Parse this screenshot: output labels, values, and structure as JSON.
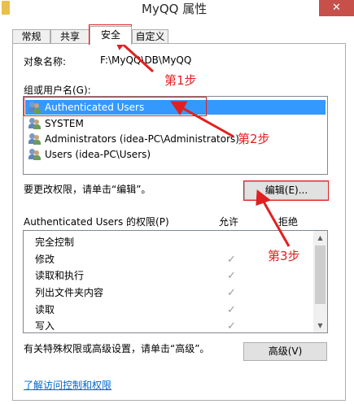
{
  "window": {
    "title": "MyQQ 属性",
    "close_glyph": "✕"
  },
  "tabs": [
    {
      "label": "常规"
    },
    {
      "label": "共享"
    },
    {
      "label": "安全"
    },
    {
      "label": "自定义"
    }
  ],
  "object": {
    "label": "对象名称:",
    "value": "F:\\MyQQ\\DB\\MyQQ"
  },
  "groups": {
    "label": "组或用户名(G):",
    "users": [
      {
        "name": "Authenticated Users",
        "selected": true
      },
      {
        "name": "SYSTEM",
        "selected": false
      },
      {
        "name": "Administrators (idea-PC\\Administrators)",
        "selected": false
      },
      {
        "name": "Users (idea-PC\\Users)",
        "selected": false
      }
    ]
  },
  "edit": {
    "hint": "要更改权限，请单击“编辑”。",
    "button_label": "编辑(E)..."
  },
  "permissions": {
    "header_label": "Authenticated Users 的权限(P)",
    "allow_label": "允许",
    "deny_label": "拒绝",
    "rows": [
      {
        "name": "完全控制",
        "allow": ""
      },
      {
        "name": "修改",
        "allow": "✓"
      },
      {
        "name": "读取和执行",
        "allow": "✓"
      },
      {
        "name": "列出文件夹内容",
        "allow": "✓"
      },
      {
        "name": "读取",
        "allow": "✓"
      },
      {
        "name": "写入",
        "allow": "✓"
      }
    ]
  },
  "advanced": {
    "hint": "有关特殊权限或高级设置，请单击“高级”。",
    "button_label": "高级(V)"
  },
  "link": {
    "label": "了解访问控制和权限"
  },
  "annotations": {
    "step1": "第1步",
    "step2": "第2步",
    "step3": "第3步",
    "color": "#e02020"
  }
}
